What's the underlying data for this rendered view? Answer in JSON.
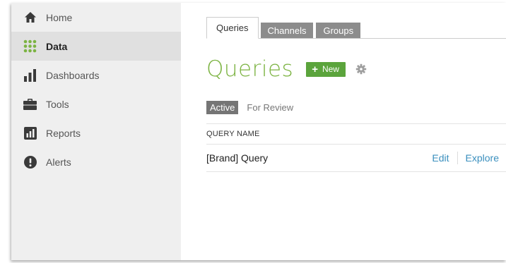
{
  "sidebar": {
    "items": [
      {
        "label": "Home",
        "icon": "home-icon"
      },
      {
        "label": "Data",
        "icon": "data-grid-icon",
        "active": true
      },
      {
        "label": "Dashboards",
        "icon": "dashboards-bar-icon"
      },
      {
        "label": "Tools",
        "icon": "briefcase-icon"
      },
      {
        "label": "Reports",
        "icon": "reports-chart-icon"
      },
      {
        "label": "Alerts",
        "icon": "alert-icon"
      }
    ]
  },
  "tabs": [
    {
      "label": "Queries",
      "active": true
    },
    {
      "label": "Channels"
    },
    {
      "label": "Groups"
    }
  ],
  "page": {
    "title": "Queries",
    "new_button": "New",
    "new_button_icon": "plus-icon",
    "settings_icon": "gear-icon"
  },
  "filters": {
    "active": "Active",
    "other": "For Review"
  },
  "table": {
    "header": "QUERY NAME",
    "rows": [
      {
        "name": "[Brand] Query",
        "edit": "Edit",
        "explore": "Explore"
      }
    ]
  },
  "colors": {
    "accent_green": "#7cb342",
    "button_green": "#5ba43c",
    "link_blue": "#3a8fbe",
    "sidebar_bg": "#efefef"
  }
}
